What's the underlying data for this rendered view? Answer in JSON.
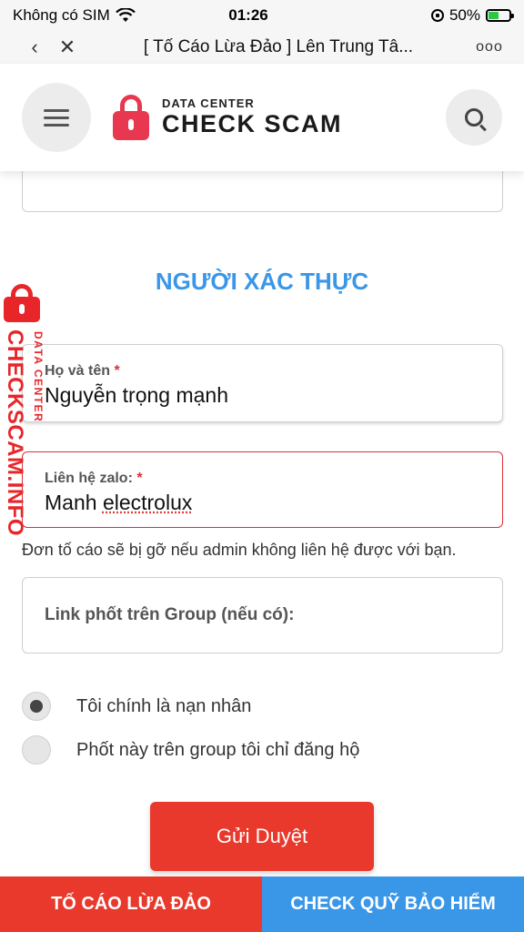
{
  "status_bar": {
    "carrier": "Không có SIM",
    "time": "01:26",
    "battery_percent": "50%",
    "battery_level": 0.5
  },
  "browser": {
    "title": "[ Tố Cáo Lừa Đảo ] Lên Trung Tâ...",
    "back_icon": "chevron-left-icon",
    "close_icon": "close-icon",
    "more_label": "ooo"
  },
  "header": {
    "brand_sub": "DATA CENTER",
    "brand_main": "CHECK SCAM",
    "menu_icon": "hamburger-icon",
    "search_icon": "search-icon"
  },
  "form": {
    "section_title": "NGƯỜI XÁC THỰC",
    "name_label": "Họ và tên",
    "name_value": "Nguyễn  trọng mạnh",
    "zalo_label": "Liên hệ zalo:",
    "zalo_value_1": "Manh ",
    "zalo_value_2": "electrolux",
    "required_mark": "*",
    "help_text": "Đơn tố cáo sẽ bị gỡ nếu admin không liên hệ được với bạn.",
    "link_placeholder": "Link phốt trên Group (nếu có):",
    "radio_options": [
      {
        "label": "Tôi chính là nạn nhân",
        "checked": true
      },
      {
        "label": "Phốt này trên group tôi chỉ đăng hộ",
        "checked": false
      }
    ],
    "submit_label": "Gửi Duyệt"
  },
  "side_badge": {
    "main": "CHECKSCAM.INFO",
    "sub": "DATA CENTER"
  },
  "bottom": {
    "left_label": "TỐ CÁO LỪA ĐẢO",
    "right_label": "CHECK QUỸ BẢO HIỂM"
  },
  "colors": {
    "accent_red": "#e8392c",
    "accent_blue": "#3a97e8",
    "error_red": "#d9303a"
  }
}
